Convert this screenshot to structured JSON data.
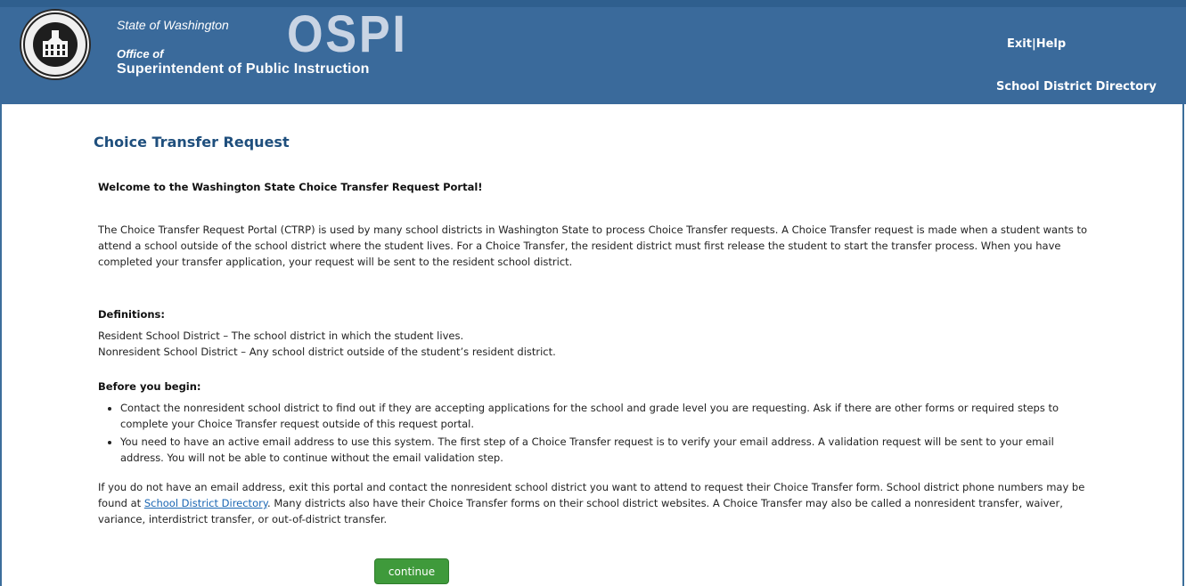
{
  "header": {
    "state": "State of Washington",
    "office": "Office of",
    "agency": "Superintendent of Public Instruction",
    "logo_text": "OSPI",
    "exit_label": "Exit",
    "separator": "|",
    "help_label": "Help",
    "directory_label": "School District Directory",
    "colors": {
      "banner": "#3a6a9b",
      "title": "#1f4f7d",
      "button": "#3f9a3b"
    }
  },
  "main": {
    "title": "Choice Transfer Request",
    "welcome": "Welcome to the Washington State Choice Transfer Request Portal!",
    "intro": "The Choice Transfer Request Portal (CTRP) is used by many school districts in Washington State to process Choice Transfer requests. A Choice Transfer request is made when a student wants to attend a school outside of the school district where the student lives. For a Choice Transfer, the resident district must first release the student to start the transfer process. When you have completed your transfer application, your request will be sent to the resident school district.",
    "definitions_heading": "Definitions:",
    "definitions": [
      "Resident School District – The school district in which the student lives.",
      "Nonresident School District – Any school district outside of the student’s resident district."
    ],
    "before_heading": "Before you begin:",
    "bullets": [
      "Contact the nonresident school district to find out if they are accepting applications for the school and grade level you are requesting. Ask if there are other forms or required steps to complete your Choice Transfer request outside of this request portal.",
      "You need to have an active email address to use this system. The first step of a Choice Transfer request is to verify your email address. A validation request will be sent to your email address. You will not be able to continue without the email validation step."
    ],
    "outro_before": "If you do not have an email address, exit this portal and contact the nonresident school district you want to attend to request their Choice Transfer form. School district phone numbers may be found at ",
    "outro_link": "School District Directory",
    "outro_after": ". Many districts also have their Choice Transfer forms on their school district websites. A Choice Transfer may also be called a nonresident transfer, waiver, variance, interdistrict transfer, or out-of-district transfer.",
    "continue_label": "continue"
  }
}
